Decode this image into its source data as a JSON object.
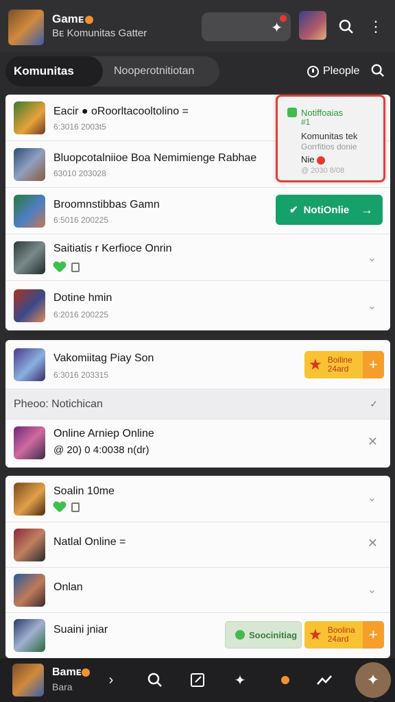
{
  "header": {
    "title": "Gamᴇ",
    "subtitle": "Bᴇ Komunitas Gatter",
    "search_icon": "search-icon",
    "more_icon": "more-vertical-icon",
    "clear_icon": "sparkle-icon",
    "badge_color": "#e33a2c"
  },
  "tabs": {
    "active": "Komunitas",
    "other": "Noopeɾotnitiotan",
    "people_label": "Pleople",
    "clock_icon": "clock-icon",
    "search_icon": "search-icon"
  },
  "notif_popup": {
    "title": "Notiffoaias",
    "count": "#1",
    "line1": "Komunitas tek",
    "line2": "Gorrfitios donie",
    "line3": "Nie",
    "line4": "@ 2030 8/08"
  },
  "card1": {
    "rows": [
      {
        "title": "Eacir ● oRoorltacooltolino =",
        "sub": "6:3016 2003t5"
      },
      {
        "title": "Bluopcotalniioe Boa Nemimienge Rabhae",
        "sub": "63010 203028"
      },
      {
        "title": "Broomnstibbas Gamn",
        "sub": "6:5016 200225",
        "button": "NotiOnlie"
      },
      {
        "title": "Saitiatis r Kerfioce Onrin",
        "sub": ""
      },
      {
        "title": "Dotine hmin",
        "sub": "6:2016 200225"
      }
    ]
  },
  "card2": {
    "row1_title": "Vakomiitag Piay Son",
    "row1_sub": "6:3016 203315",
    "gold_btn_text": "Boiline 24ard",
    "section_label": "Pheoo: Notichican",
    "row2_title": "Online  Arniep Online",
    "row2_sub": "@ 20) 0 4:0038 n(dr)"
  },
  "card3": {
    "rows": [
      {
        "title": "Soalin 10me"
      },
      {
        "title": "Natlal Online ="
      },
      {
        "title": "Onlan"
      },
      {
        "title": "Suaini jniar",
        "social_btn": "Soocinitiag",
        "gold_btn": "Boolina 24ard"
      }
    ]
  },
  "bottom": {
    "title": "Bamᴇ",
    "subtitle": "Bara"
  },
  "colors": {
    "accent_green": "#16a06a",
    "accent_gold": "#f8c233",
    "alert_red": "#d9423d"
  }
}
